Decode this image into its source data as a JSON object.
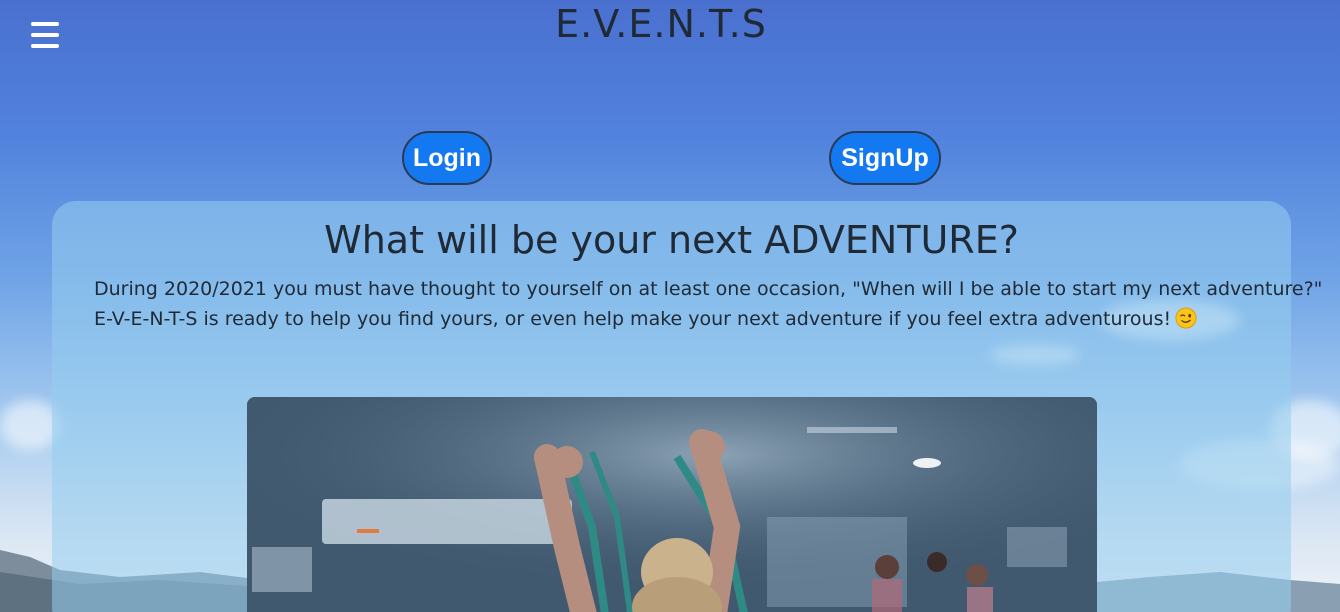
{
  "header": {
    "title": "E.V.E.N.T.S",
    "menu_icon": "hamburger-icon"
  },
  "auth": {
    "login_label": "Login",
    "signup_label": "SignUp"
  },
  "main": {
    "heading": "What will be your next ADVENTURE?",
    "paragraph_line1": "During 2020/2021 you must have thought to yourself on at least one occasion, \"When will I be able to start my next adventure?\"",
    "paragraph_line2": "E-V-E-N-T-S is ready to help you find yours, or even help make your next adventure if you feel extra adventurous!",
    "emoji_icon": "winking-face-icon",
    "image_subject": "fitness-class-photo"
  },
  "colors": {
    "button_blue": "#1479f0",
    "title_text": "#1f2a36",
    "sky_top": "#4a70cf"
  }
}
